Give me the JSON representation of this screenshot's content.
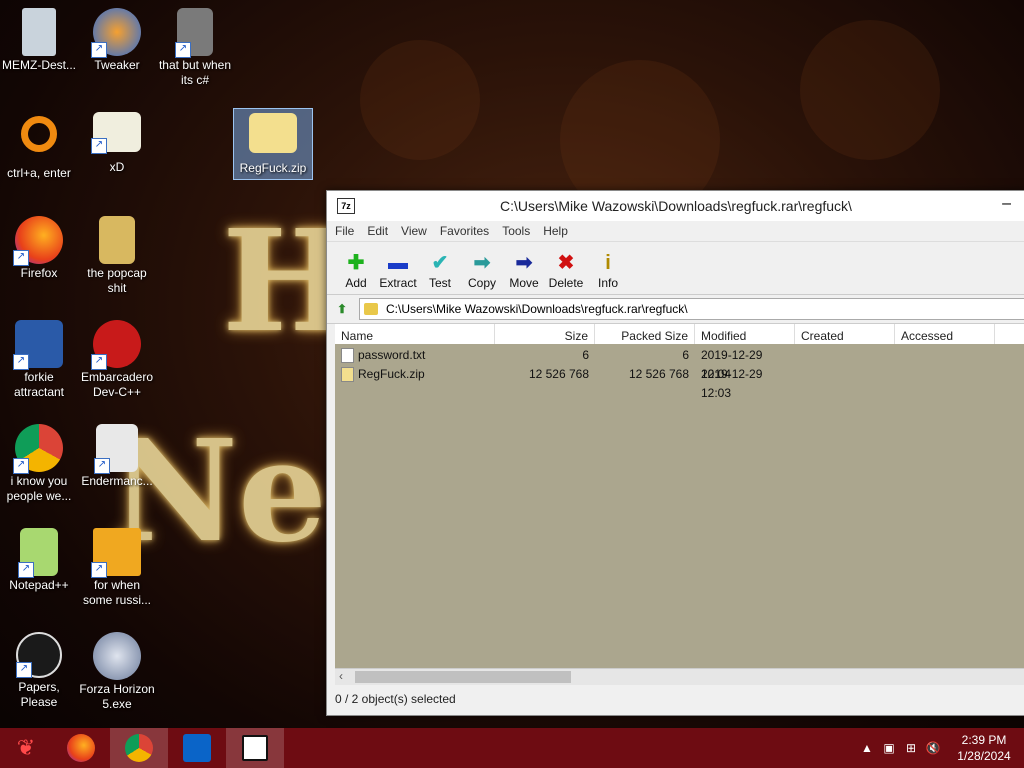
{
  "desktop": {
    "icons": [
      {
        "label": "MEMZ-Dest..."
      },
      {
        "label": "Tweaker"
      },
      {
        "label": "that but when its c#"
      },
      {
        "label": "ctrl+a, enter"
      },
      {
        "label": "xD"
      },
      {
        "label": "RegFuck.zip"
      },
      {
        "label": "Firefox"
      },
      {
        "label": "the popcap shit"
      },
      {
        "label": "forkie attractant"
      },
      {
        "label": "Embarcadero Dev-C++"
      },
      {
        "label": "i know you people we..."
      },
      {
        "label": "Endermanc..."
      },
      {
        "label": "Notepad++"
      },
      {
        "label": "for when some russi..."
      },
      {
        "label": "Papers, Please"
      },
      {
        "label": "Forza Horizon 5.exe"
      }
    ]
  },
  "window": {
    "title": "C:\\Users\\Mike Wazowski\\Downloads\\regfuck.rar\\regfuck\\",
    "app_icon": "7z",
    "minimize": "–",
    "menu": [
      "File",
      "Edit",
      "View",
      "Favorites",
      "Tools",
      "Help"
    ],
    "toolbar": [
      {
        "label": "Add",
        "icon": "plus-icon",
        "glyph": "✚",
        "color": "#1db21d"
      },
      {
        "label": "Extract",
        "icon": "minus-icon",
        "glyph": "▬",
        "color": "#1a3cc8"
      },
      {
        "label": "Test",
        "icon": "check-icon",
        "glyph": "✔",
        "color": "#2ab4b4"
      },
      {
        "label": "Copy",
        "icon": "copy-arrow-icon",
        "glyph": "➡",
        "color": "#2a9a9a"
      },
      {
        "label": "Move",
        "icon": "move-arrow-icon",
        "glyph": "➡",
        "color": "#1a2a9a"
      },
      {
        "label": "Delete",
        "icon": "delete-x-icon",
        "glyph": "✖",
        "color": "#d01010"
      },
      {
        "label": "Info",
        "icon": "info-icon",
        "glyph": "i",
        "color": "#b08a00"
      }
    ],
    "address": "C:\\Users\\Mike Wazowski\\Downloads\\regfuck.rar\\regfuck\\",
    "columns": [
      "Name",
      "Size",
      "Packed Size",
      "Modified",
      "Created",
      "Accessed"
    ],
    "files": [
      {
        "name": "password.txt",
        "size": "6",
        "packed": "6",
        "modified": "2019-12-29 12:04",
        "created": "",
        "accessed": ""
      },
      {
        "name": "RegFuck.zip",
        "size": "12 526 768",
        "packed": "12 526 768",
        "modified": "2019-12-29 12:03",
        "created": "",
        "accessed": ""
      }
    ],
    "status": "0 / 2 object(s) selected"
  },
  "taskbar": {
    "time": "2:39 PM",
    "date": "1/28/2024"
  },
  "colors": {
    "taskbar": "#6e0c12",
    "list_bg": "#aba68e",
    "selection": "#9cc4f0"
  }
}
